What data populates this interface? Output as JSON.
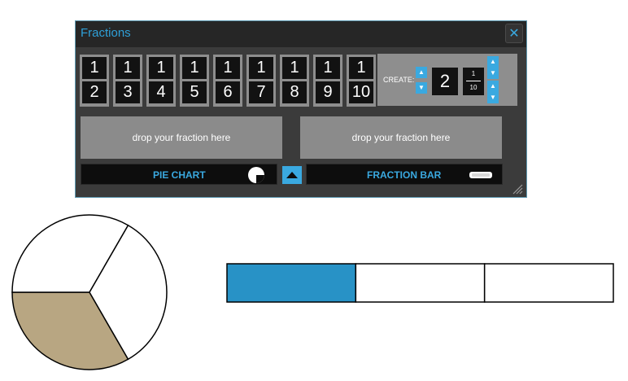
{
  "window": {
    "title": "Fractions"
  },
  "tiles": [
    {
      "numerator": "1",
      "denominator": "2"
    },
    {
      "numerator": "1",
      "denominator": "3"
    },
    {
      "numerator": "1",
      "denominator": "4"
    },
    {
      "numerator": "1",
      "denominator": "5"
    },
    {
      "numerator": "1",
      "denominator": "6"
    },
    {
      "numerator": "1",
      "denominator": "7"
    },
    {
      "numerator": "1",
      "denominator": "8"
    },
    {
      "numerator": "1",
      "denominator": "9"
    },
    {
      "numerator": "1",
      "denominator": "10"
    }
  ],
  "create": {
    "label": "CREATE:",
    "value": "2",
    "fraction": {
      "numerator": "1",
      "denominator": "10"
    }
  },
  "drop_zones": {
    "left": "drop your fraction here",
    "right": "drop your fraction here"
  },
  "buttons": {
    "pie_chart": "PIE CHART",
    "fraction_bar": "FRACTION BAR"
  },
  "pie": {
    "slices": 3,
    "shaded": 1,
    "shade_color": "#b8a682"
  },
  "fraction_bar": {
    "segments": 3,
    "shaded": 1,
    "shade_color": "#2892c6"
  },
  "colors": {
    "accent": "#3aa9e0",
    "panel": "#3b3b3b"
  }
}
